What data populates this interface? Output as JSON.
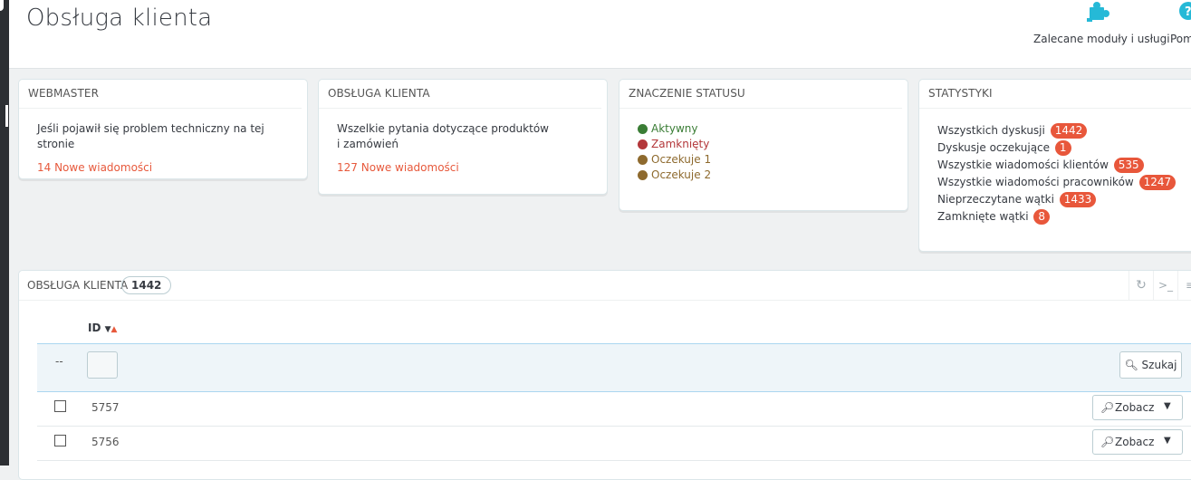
{
  "header": {
    "title": "Obsługa klienta",
    "toolbar": [
      {
        "label": "Zalecane moduły i usługi",
        "icon": "puzzle-icon"
      },
      {
        "label": "Pom",
        "icon": "help-icon"
      }
    ]
  },
  "cards": {
    "webmaster": {
      "title": "WEBMASTER",
      "text": "Jeśli pojawił się problem techniczny na tej stronie",
      "link": "14 Nowe wiadomości"
    },
    "customer_service": {
      "title": "OBSŁUGA KLIENTA",
      "text": "Wszelkie pytania dotyczące produktów i zamówień",
      "link": "127 Nowe wiadomości"
    },
    "status_legend": {
      "title": "ZNACZENIE STATUSU",
      "items": [
        {
          "label": "Aktywny",
          "color": "#3a7d35"
        },
        {
          "label": "Zamknięty",
          "color": "#b3373a"
        },
        {
          "label": "Oczekuje 1",
          "color": "#8e6a2e"
        },
        {
          "label": "Oczekuje 2",
          "color": "#8e6a2e"
        }
      ]
    },
    "stats": {
      "title": "STATYSTYKI",
      "items": [
        {
          "label": "Wszystkich dyskusji",
          "value": "1442"
        },
        {
          "label": "Dyskusje oczekujące",
          "value": "1"
        },
        {
          "label": "Wszystkie wiadomości klientów",
          "value": "535"
        },
        {
          "label": "Wszystkie wiadomości pracowników",
          "value": "1247"
        },
        {
          "label": "Nieprzeczytane wątki",
          "value": "1433"
        },
        {
          "label": "Zamknięte wątki",
          "value": "8"
        }
      ]
    }
  },
  "list": {
    "title": "OBSŁUGA KLIENTA",
    "count": "1442",
    "column_id": "ID",
    "filter_dash": "--",
    "search_label": "Szukaj",
    "rows": [
      {
        "id": "5757",
        "action": "Zobacz"
      },
      {
        "id": "5756",
        "action": "Zobacz"
      }
    ]
  },
  "colors": {
    "accent": "#e7593c",
    "badge": "#e8573b",
    "filter_bg": "#eef5f9",
    "teal_icon": "#25b9d7"
  }
}
